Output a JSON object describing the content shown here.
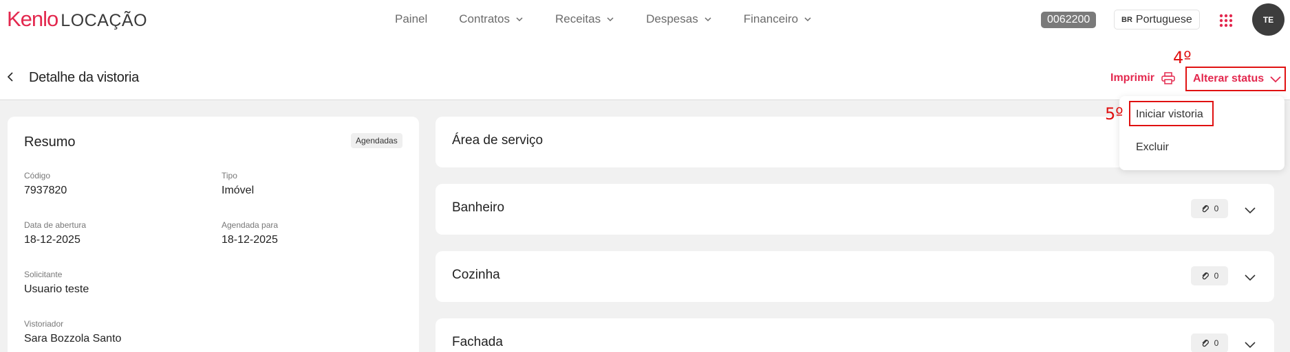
{
  "brand": {
    "name": "Kenlo",
    "product": "LOCAÇÃO"
  },
  "nav": [
    {
      "label": "Painel",
      "dropdown": false
    },
    {
      "label": "Contratos",
      "dropdown": true
    },
    {
      "label": "Receitas",
      "dropdown": true
    },
    {
      "label": "Despesas",
      "dropdown": true
    },
    {
      "label": "Financeiro",
      "dropdown": true
    }
  ],
  "account": {
    "code": "0062200",
    "language_flag": "BR",
    "language": "Portuguese",
    "avatar_initials": "TE"
  },
  "header": {
    "title": "Detalhe da vistoria",
    "print_label": "Imprimir",
    "status_label": "Alterar status"
  },
  "annotations": {
    "step4": "4º",
    "step5": "5º"
  },
  "status_menu": {
    "items": [
      "Iniciar vistoria",
      "Excluir"
    ]
  },
  "summary": {
    "title": "Resumo",
    "badge": "Agendadas",
    "fields": {
      "codigo": {
        "label": "Código",
        "value": "7937820"
      },
      "tipo": {
        "label": "Tipo",
        "value": "Imóvel"
      },
      "abertura": {
        "label": "Data de abertura",
        "value": "18-12-2025"
      },
      "agendada": {
        "label": "Agendada para",
        "value": "18-12-2025"
      },
      "solicitante": {
        "label": "Solicitante",
        "value": "Usuario teste"
      },
      "vistoriador": {
        "label": "Vistoriador",
        "value": "Sara Bozzola Santo"
      }
    }
  },
  "sections": [
    {
      "title": "Área de serviço",
      "attachments": ""
    },
    {
      "title": "Banheiro",
      "attachments": "0"
    },
    {
      "title": "Cozinha",
      "attachments": "0"
    },
    {
      "title": "Fachada",
      "attachments": "0"
    }
  ],
  "colors": {
    "accent": "#e3284e",
    "annotation": "#e01010",
    "page_bg": "#f1f1f1",
    "badge_bg": "#7a7a7a"
  }
}
